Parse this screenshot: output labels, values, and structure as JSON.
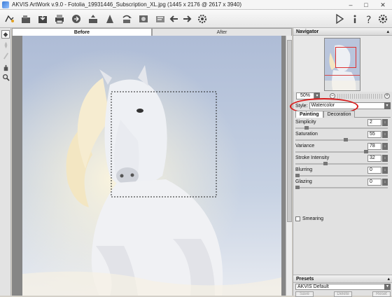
{
  "window": {
    "title": "AKVIS ArtWork v.9.0 - Fotolia_19931446_Subscription_XL.jpg (1445 x 2176 @ 2617 x 3940)",
    "min_label": "–",
    "max_label": "□",
    "close_label": "✕"
  },
  "view_tabs": {
    "before": "Before",
    "after": "After"
  },
  "navigator": {
    "header": "Navigator",
    "collapse": "▴",
    "zoom": "50%",
    "zoom_dd": "▾",
    "minus": "–",
    "plus": "+"
  },
  "settings": {
    "style_label": "Style:",
    "style_value": "Watercolor",
    "dd": "▾",
    "tabs": [
      "Painting",
      "Decoration"
    ],
    "params": [
      {
        "label": "Simplicity",
        "value": "2",
        "fraction": 0.1
      },
      {
        "label": "Saturation",
        "value": "55",
        "fraction": 0.55
      },
      {
        "label": "Variance",
        "value": "78",
        "fraction": 0.78
      },
      {
        "label": "Stroke Intensity",
        "value": "32",
        "fraction": 0.32
      },
      {
        "label": "Blurring",
        "value": "0",
        "fraction": 0.0
      },
      {
        "label": "Glazing",
        "value": "0",
        "fraction": 0.0
      }
    ],
    "spin": "↕",
    "smearing_label": "Smearing"
  },
  "presets": {
    "header": "Presets",
    "collapse": "▴",
    "selected": "AKVIS Default",
    "dd": "▾",
    "save": "Save",
    "delete": "Delete",
    "reset": "Reset"
  }
}
